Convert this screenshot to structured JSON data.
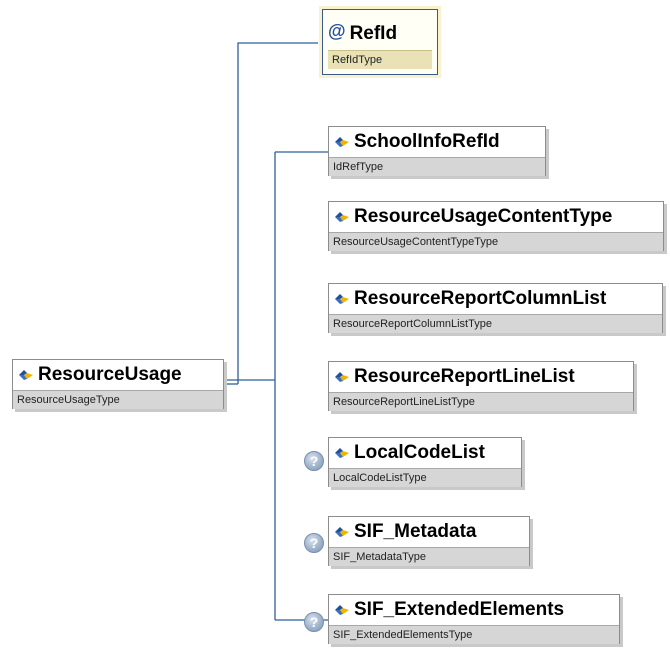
{
  "diagram": {
    "root": {
      "name": "ResourceUsage",
      "type": "ResourceUsageType"
    },
    "attribute": {
      "symbol": "@",
      "name": "RefId",
      "type": "RefIdType"
    },
    "children": [
      {
        "name": "SchoolInfoRefId",
        "type": "IdRefType",
        "optional": false
      },
      {
        "name": "ResourceUsageContentType",
        "type": "ResourceUsageContentTypeType",
        "optional": false
      },
      {
        "name": "ResourceReportColumnList",
        "type": "ResourceReportColumnListType",
        "optional": false
      },
      {
        "name": "ResourceReportLineList",
        "type": "ResourceReportLineListType",
        "optional": false
      },
      {
        "name": "LocalCodeList",
        "type": "LocalCodeListType",
        "optional": true,
        "optional_symbol": "?"
      },
      {
        "name": "SIF_Metadata",
        "type": "SIF_MetadataType",
        "optional": true,
        "optional_symbol": "?"
      },
      {
        "name": "SIF_ExtendedElements",
        "type": "SIF_ExtendedElementsType",
        "optional": true,
        "optional_symbol": "?"
      }
    ],
    "colors": {
      "connector": "#2f5f9f",
      "node_border": "#8c8c8c",
      "type_bar": "#d6d6d6",
      "attribute_border": "#3a5a8c",
      "attribute_fill": "#fffff6",
      "element_icon": "diamond-element-icon",
      "optional_icon": "question-mark-icon"
    }
  }
}
